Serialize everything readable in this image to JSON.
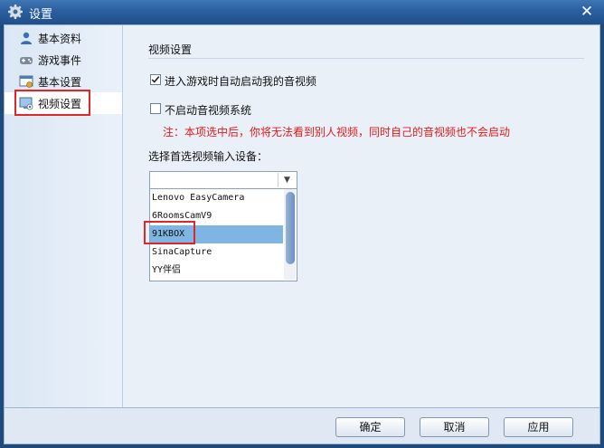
{
  "window": {
    "title": "设置"
  },
  "sidebar": {
    "items": [
      {
        "label": "基本资料",
        "icon": "user-icon"
      },
      {
        "label": "游戏事件",
        "icon": "gamepad-icon"
      },
      {
        "label": "基本设置",
        "icon": "window-settings-icon"
      },
      {
        "label": "视频设置",
        "icon": "monitor-icon",
        "selected": true
      }
    ]
  },
  "video": {
    "section_title": "视频设置",
    "auto_start_label": "进入游戏时自动启动我的音视频",
    "auto_start_checked": true,
    "disable_label": "不启动音视频系统",
    "disable_checked": false,
    "warning": "注：本项选中后，你将无法看到别人视频，同时自己的音视频也不会启动",
    "select_label": "选择首选视频输入设备：",
    "dropdown_value": "",
    "devices": [
      "Lenovo EasyCamera",
      "6RoomsCamV9",
      "91KBOX",
      "SinaCapture",
      "YY伴侣"
    ],
    "selected_device": "91KBOX"
  },
  "buttons": {
    "ok": "确定",
    "cancel": "取消",
    "apply": "应用"
  },
  "colors": {
    "warning": "#e21b1b",
    "selection": "#7fb5e2",
    "highlight_box": "#e0262a"
  }
}
